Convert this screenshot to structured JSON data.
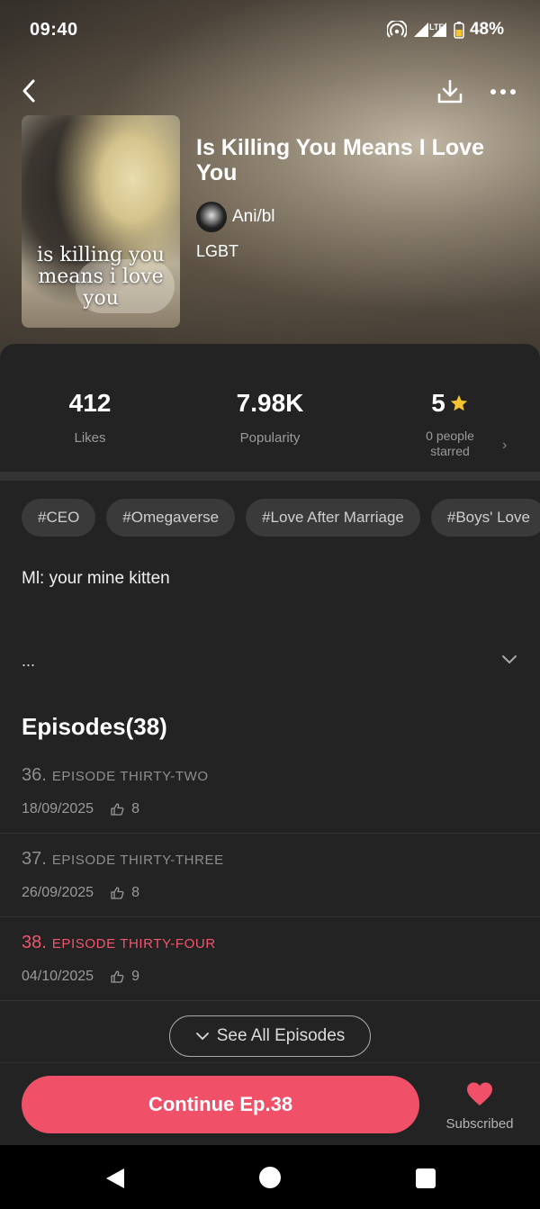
{
  "status_bar": {
    "time": "09:40",
    "battery": "48%",
    "network": "LTE"
  },
  "header": {
    "title": "Is Killing You Means I Love You",
    "author": "Ani/bl",
    "genre": "LGBT",
    "cover_text": "is killing you means i love you"
  },
  "stats": {
    "likes_value": "412",
    "likes_label": "Likes",
    "popularity_value": "7.98K",
    "popularity_label": "Popularity",
    "rating_value": "5",
    "rating_sub_line1": "0 people",
    "rating_sub_line2": "starred"
  },
  "tags": [
    "#CEO",
    "#Omegaverse",
    "#Love After Marriage",
    "#Boys' Love"
  ],
  "description": {
    "text": "Ml: your mine kitten",
    "ellipsis": "..."
  },
  "episodes": {
    "heading": "Episodes(38)",
    "items": [
      {
        "number": "36.",
        "name": "EPISODE THIRTY-TWO",
        "date": "18/09/2025",
        "likes": "8"
      },
      {
        "number": "37.",
        "name": "EPISODE THIRTY-THREE",
        "date": "26/09/2025",
        "likes": "8"
      },
      {
        "number": "38.",
        "name": "EPISODE THIRTY-FOUR",
        "date": "04/10/2025",
        "likes": "9"
      }
    ],
    "see_all_label": "See All Episodes"
  },
  "bottom": {
    "continue_label": "Continue Ep.38",
    "subscribe_label": "Subscribed"
  },
  "colors": {
    "accent": "#f05068",
    "star": "#f7c32e",
    "sheet": "#232323"
  },
  "icons": [
    "back-arrow-icon",
    "download-icon",
    "more-icon",
    "star-icon",
    "thumbs-up-icon",
    "chevron-down-icon",
    "heart-icon"
  ]
}
